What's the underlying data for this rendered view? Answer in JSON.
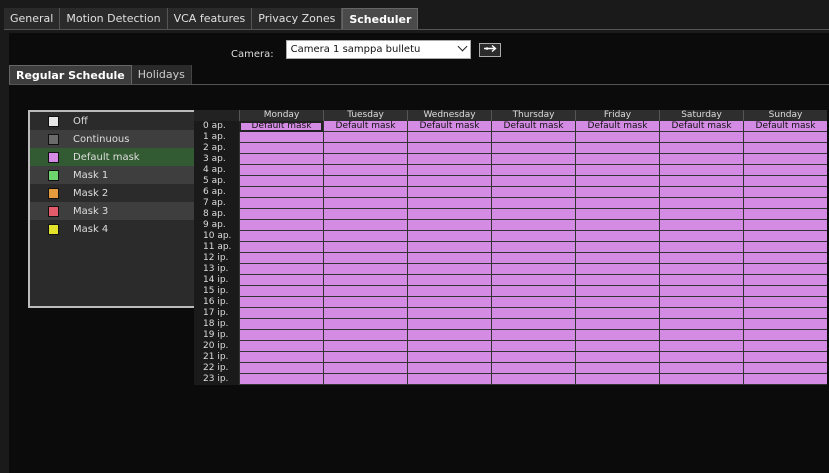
{
  "tabs": [
    "General",
    "Motion Detection",
    "VCA features",
    "Privacy Zones",
    "Scheduler"
  ],
  "active_tab": "Scheduler",
  "camera": {
    "label": "Camera:",
    "value": "Camera 1 samppa bulletu"
  },
  "subtabs": [
    "Regular Schedule",
    "Holidays"
  ],
  "legend": [
    {
      "label": "Off",
      "color": "#e6e6e6"
    },
    {
      "label": "Continuous",
      "color": "#6b6b6b"
    },
    {
      "label": "Default mask",
      "color": "#d48be3"
    },
    {
      "label": "Mask 1",
      "color": "#6ed46e"
    },
    {
      "label": "Mask 2",
      "color": "#e39b3e"
    },
    {
      "label": "Mask 3",
      "color": "#e35b6b"
    },
    {
      "label": "Mask 4",
      "color": "#e3e32b"
    }
  ],
  "days": [
    "Monday",
    "Tuesday",
    "Wednesday",
    "Thursday",
    "Friday",
    "Saturday",
    "Sunday"
  ],
  "hours": [
    "0 ap.",
    "1 ap.",
    "2 ap.",
    "3 ap.",
    "4 ap.",
    "5 ap.",
    "6 ap.",
    "7 ap.",
    "8 ap.",
    "9 ap.",
    "10 ap.",
    "11 ap.",
    "12 ip.",
    "13 ip.",
    "14 ip.",
    "15 ip.",
    "16 ip.",
    "17 ip.",
    "18 ip.",
    "19 ip.",
    "20 ip.",
    "21 ip.",
    "22 ip.",
    "23 ip."
  ],
  "cell_label": "Default mask",
  "cell_color": "#d48be3"
}
